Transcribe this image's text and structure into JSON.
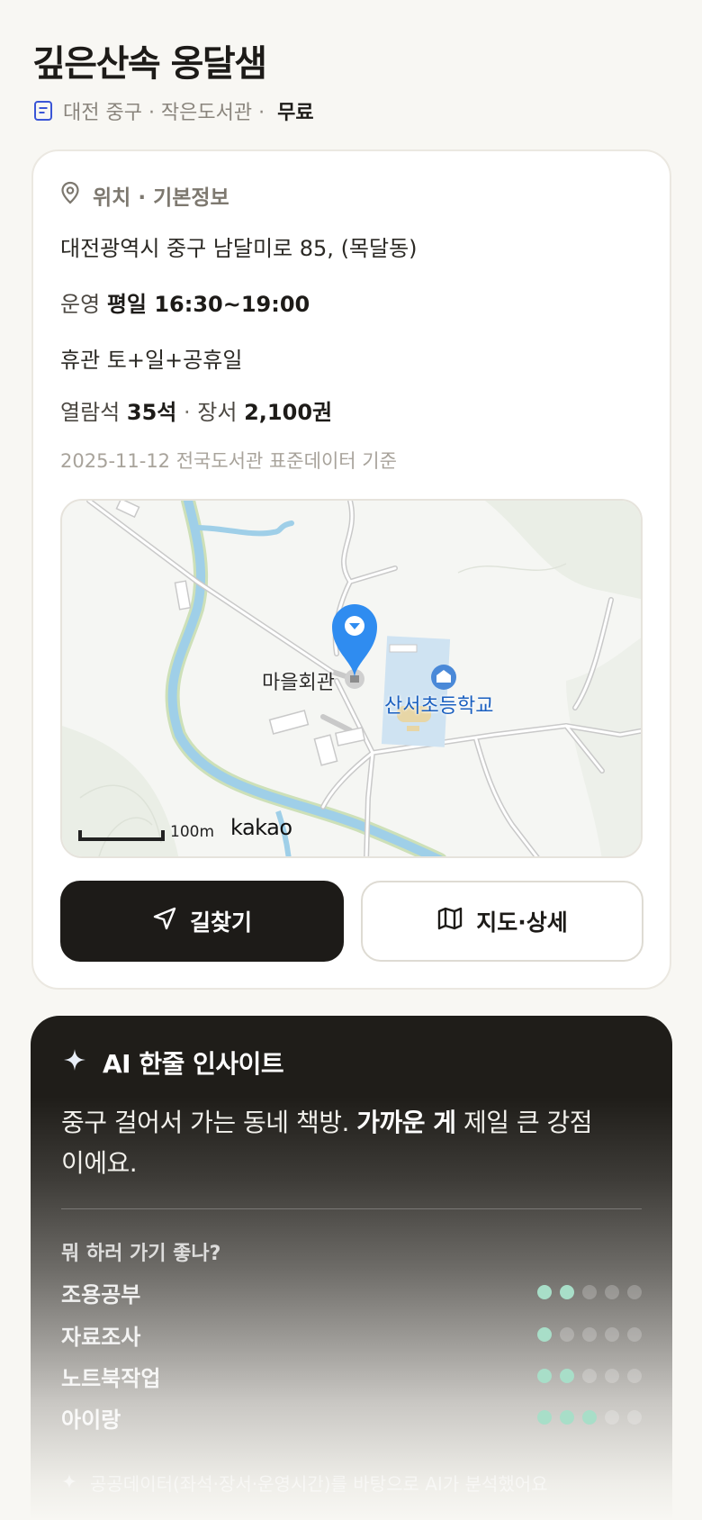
{
  "header": {
    "title": "깊은산속 옹달샘",
    "meta_text": "대전 중구 · 작은도서관 ·",
    "fee": "무료"
  },
  "info": {
    "section_title": "위치 · 기본정보",
    "address": "대전광역시 중구 남달미로 85, (목달동)",
    "hours_label": "운영",
    "hours_value": "평일 16:30~19:00",
    "closed_text": "휴관 토+일+공휴일",
    "seats_label": "열람석",
    "seats_value": "35석",
    "sep": "·",
    "books_label": "장서",
    "books_value": "2,100권",
    "source_note": "2025-11-12 전국도서관 표준데이터 기준"
  },
  "map": {
    "place_label": "마을회관",
    "school_label": "산서초등학교",
    "scale_label": "100m",
    "provider": "kakao",
    "marker_color": "#2f8cf0"
  },
  "actions": {
    "route_label": "길찾기",
    "map_label": "지도·상세"
  },
  "ai": {
    "title": "AI 한줄 인사이트",
    "insight_pre": "중구 걸어서 가는 동네 책방. ",
    "insight_bold": "가까운 게",
    "insight_post": " 제일 큰 강점이에요.",
    "question": "뭐 하러 가기 좋나?",
    "activities": [
      {
        "name": "조용공부",
        "score": 2
      },
      {
        "name": "자료조사",
        "score": 1
      },
      {
        "name": "노트북작업",
        "score": 2
      },
      {
        "name": "아이랑",
        "score": 3
      }
    ],
    "max_score": 5,
    "footer": "공공데이터(좌석·장서·운영시간)를 바탕으로 AI가 분석했어요",
    "dot_on_color": "#a8dec8"
  }
}
